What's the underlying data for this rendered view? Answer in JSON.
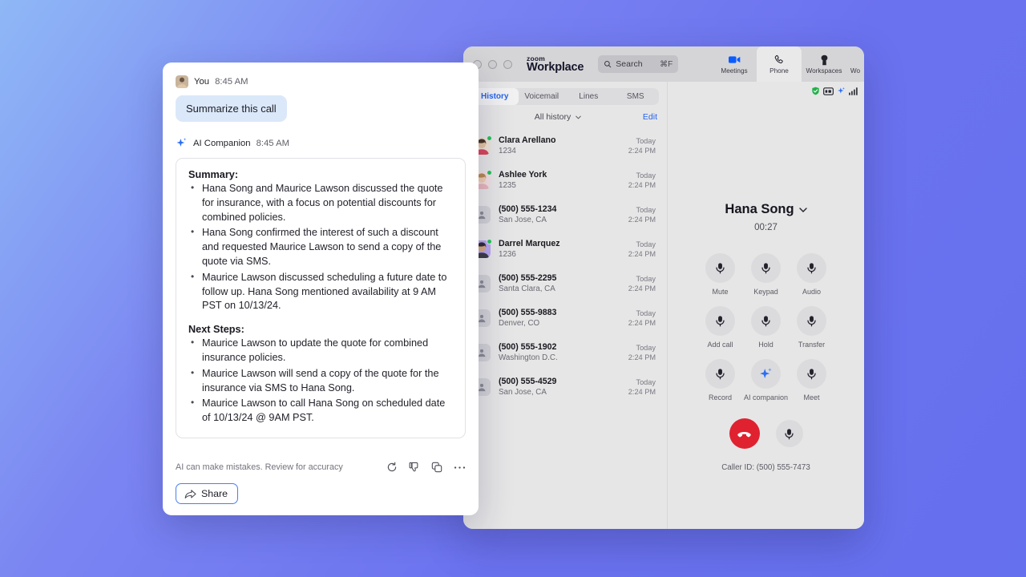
{
  "zoom_window": {
    "titlebar": {
      "brand_small": "zoom",
      "brand_large": "Workplace",
      "search_placeholder": "Search",
      "search_shortcut": "⌘F",
      "nav": [
        {
          "label": "Meetings",
          "icon": "video-camera-icon",
          "active": false
        },
        {
          "label": "Phone",
          "icon": "phone-handset-icon",
          "active": true
        },
        {
          "label": "Workspaces",
          "icon": "workspace-pin-icon",
          "active": false
        },
        {
          "label": "Wo",
          "icon": "more-nav-icon",
          "active": false
        }
      ]
    },
    "history": {
      "tabs": [
        {
          "label": "History",
          "active": true
        },
        {
          "label": "Voicemail",
          "active": false
        },
        {
          "label": "Lines",
          "active": false
        },
        {
          "label": "SMS",
          "active": false
        }
      ],
      "filter_label": "All history",
      "edit_label": "Edit",
      "calls": [
        {
          "name": "Clara Arellano",
          "sub": "1234",
          "day": "Today",
          "time": "2:24 PM",
          "avatar": "photo-1",
          "online": true
        },
        {
          "name": "Ashlee York",
          "sub": "1235",
          "day": "Today",
          "time": "2:24 PM",
          "avatar": "photo-2",
          "online": true
        },
        {
          "name": "(500) 555-1234",
          "sub": "San Jose, CA",
          "day": "Today",
          "time": "2:24 PM",
          "avatar": "generic",
          "online": false
        },
        {
          "name": "Darrel Marquez",
          "sub": "1236",
          "day": "Today",
          "time": "2:24 PM",
          "avatar": "photo-3",
          "online": true
        },
        {
          "name": "(500) 555-2295",
          "sub": "Santa Clara, CA",
          "day": "Today",
          "time": "2:24 PM",
          "avatar": "generic",
          "online": false
        },
        {
          "name": "(500) 555-9883",
          "sub": "Denver, CO",
          "day": "Today",
          "time": "2:24 PM",
          "avatar": "generic",
          "online": false
        },
        {
          "name": "(500) 555-1902",
          "sub": "Washington D.C.",
          "day": "Today",
          "time": "2:24 PM",
          "avatar": "generic",
          "online": false
        },
        {
          "name": "(500) 555-4529",
          "sub": "San Jose, CA",
          "day": "Today",
          "time": "2:24 PM",
          "avatar": "generic",
          "online": false
        }
      ]
    },
    "active_call": {
      "status_icons": [
        "shield-icon",
        "captions-icon",
        "ai-sparkle-icon",
        "signal-bars-icon"
      ],
      "callee_name": "Hana Song",
      "timer": "00:27",
      "controls": [
        {
          "label": "Mute",
          "icon": "microphone-icon"
        },
        {
          "label": "Keypad",
          "icon": "microphone-icon"
        },
        {
          "label": "Audio",
          "icon": "microphone-icon"
        },
        {
          "label": "Add call",
          "icon": "microphone-icon"
        },
        {
          "label": "Hold",
          "icon": "microphone-icon"
        },
        {
          "label": "Transfer",
          "icon": "microphone-icon"
        },
        {
          "label": "Record",
          "icon": "microphone-icon"
        },
        {
          "label": "AI companion",
          "icon": "ai-sparkle-icon"
        },
        {
          "label": "Meet",
          "icon": "microphone-icon"
        }
      ],
      "end_call_icon": "end-call-icon",
      "extra_icon": "microphone-icon",
      "caller_id": "Caller ID: (500) 555-7473"
    }
  },
  "chat_panel": {
    "user_message": {
      "author": "You",
      "time": "8:45 AM",
      "text": "Summarize this call"
    },
    "ai_message": {
      "author": "AI Companion",
      "time": "8:45 AM",
      "summary_title": "Summary:",
      "summary_points": [
        "Hana Song and Maurice Lawson discussed the quote for insurance, with a focus on potential discounts for combined policies.",
        "Hana Song confirmed the interest of such a discount and requested Maurice Lawson to send a copy of the quote via SMS.",
        "Maurice Lawson discussed scheduling a future date to follow up. Hana Song mentioned availability at 9 AM PST on 10/13/24."
      ],
      "next_steps_title": "Next Steps:",
      "next_steps_points": [
        "Maurice Lawson to update the quote for combined insurance policies.",
        "Maurice Lawson will send a copy of the quote for the insurance via SMS to Hana Song.",
        "Maurice Lawson to call Hana Song on scheduled date of 10/13/24 @ 9AM PST."
      ]
    },
    "footer": {
      "disclaimer": "AI can make mistakes. Review for accuracy",
      "actions": [
        "regenerate-icon",
        "thumbs-down-icon",
        "copy-icon",
        "more-options-icon"
      ],
      "share_label": "Share"
    }
  },
  "colors": {
    "accent_blue": "#2563eb",
    "bubble_blue": "#dbe8fa",
    "end_call_red": "#e02130",
    "online_green": "#25c25a",
    "sparkle_blue": "#2b6ef5"
  }
}
